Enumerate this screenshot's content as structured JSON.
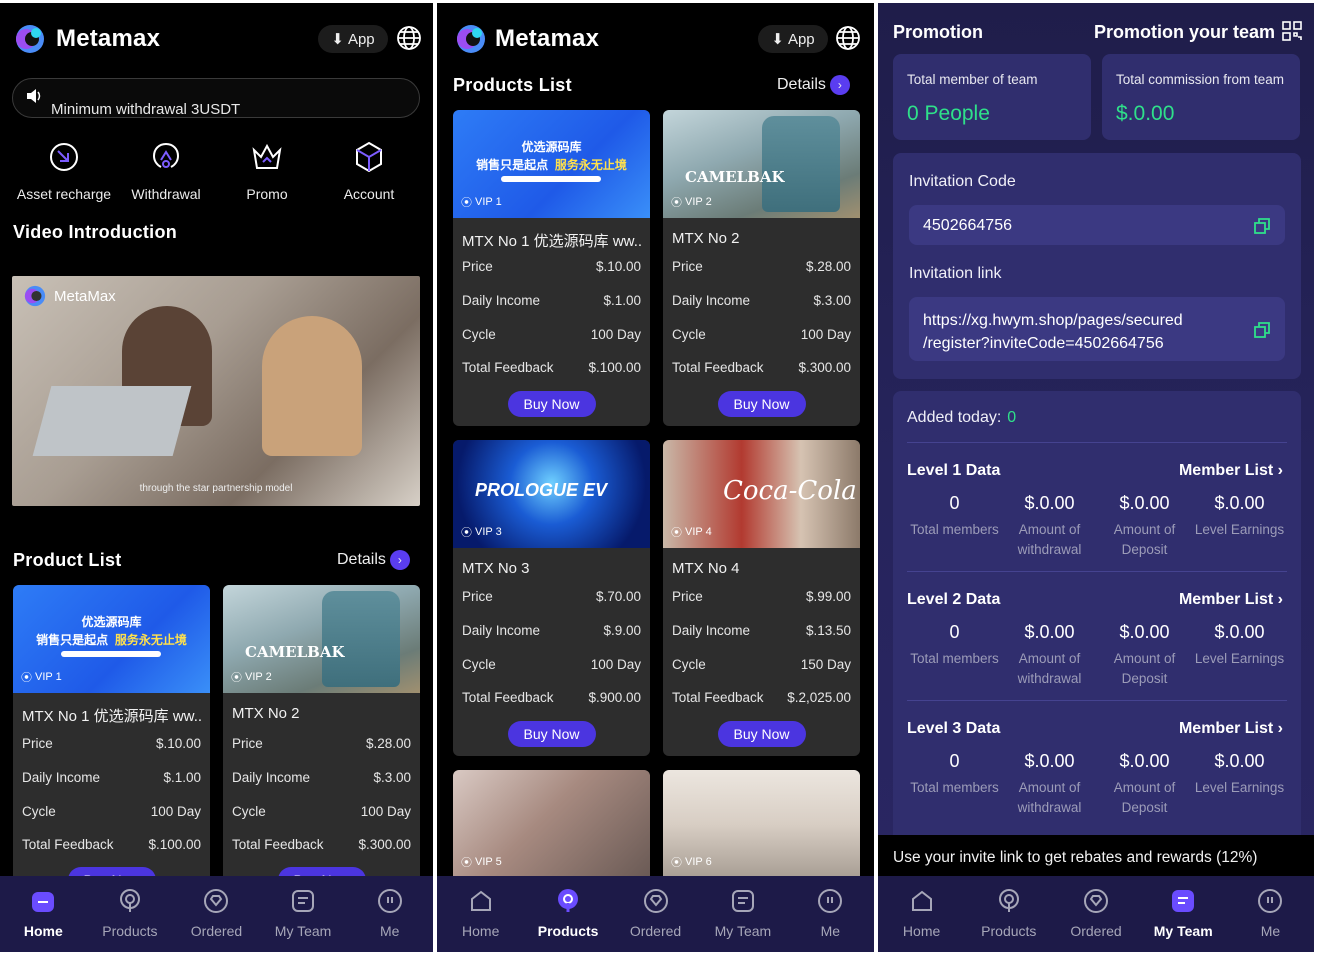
{
  "header": {
    "brand": "Metamax",
    "app_label": "App"
  },
  "home": {
    "notice": "Minimum withdrawal 3USDT",
    "actions": [
      "Asset recharge",
      "Withdrawal",
      "Promo",
      "Account"
    ],
    "video_title": "Video Introduction",
    "video_logo": "MetaMax",
    "video_caption": "through the star partnership model",
    "product_title": "Product List",
    "details": "Details"
  },
  "products_page": {
    "title": "Products List",
    "details": "Details"
  },
  "labels": {
    "price": "Price",
    "daily": "Daily Income",
    "cycle": "Cycle",
    "feedback": "Total Feedback",
    "buy": "Buy Now"
  },
  "products": [
    {
      "name": "MTX No 1 优选源码库 ww...",
      "vip": "VIP 1",
      "price": "$.10.00",
      "daily": "$.1.00",
      "cycle": "100 Day",
      "feedback": "$.100.00"
    },
    {
      "name": "MTX No 2",
      "vip": "VIP 2",
      "price": "$.28.00",
      "daily": "$.3.00",
      "cycle": "100 Day",
      "feedback": "$.300.00"
    },
    {
      "name": "MTX No 3",
      "vip": "VIP 3",
      "price": "$.70.00",
      "daily": "$.9.00",
      "cycle": "100 Day",
      "feedback": "$.900.00"
    },
    {
      "name": "MTX No 4",
      "vip": "VIP 4",
      "price": "$.99.00",
      "daily": "$.13.50",
      "cycle": "150 Day",
      "feedback": "$.2,025.00"
    },
    {
      "vip": "VIP 5"
    },
    {
      "vip": "VIP 6"
    }
  ],
  "banners": {
    "yx_title": "优选源码库",
    "yx_slogan_white": "销售只是起点",
    "yx_slogan_yellow": "服务永无止境",
    "camelbak": "CAMELBAK",
    "ev": "PROLOGUE EV",
    "coke": "Coca-Cola"
  },
  "team": {
    "title": "Promotion",
    "subtitle": "Promotion your team",
    "total_member_label": "Total member of team",
    "total_member_value": "0 People",
    "commission_label": "Total commission from team",
    "commission_value": "$.0.00",
    "invitation_code_label": "Invitation Code",
    "invitation_code": "4502664756",
    "invitation_link_label": "Invitation link",
    "invitation_link_1": "https://xg.hwym.shop/pages/secured",
    "invitation_link_2": "/register?inviteCode=4502664756",
    "added_today_label": "Added today:",
    "added_today_value": "0",
    "member_list": "Member List",
    "levels": [
      {
        "title": "Level 1 Data",
        "members": "0",
        "withdrawal": "$.0.00",
        "deposit": "$.0.00",
        "earnings": "$.0.00"
      },
      {
        "title": "Level 2 Data",
        "members": "0",
        "withdrawal": "$.0.00",
        "deposit": "$.0.00",
        "earnings": "$.0.00"
      },
      {
        "title": "Level 3 Data",
        "members": "0",
        "withdrawal": "$.0.00",
        "deposit": "$.0.00",
        "earnings": "$.0.00"
      }
    ],
    "col_labels": {
      "members": "Total members",
      "withdrawal_1": "Amount of",
      "withdrawal_2": "withdrawal",
      "deposit_1": "Amount of",
      "deposit_2": "Deposit",
      "earnings": "Level Earnings"
    },
    "invite_hint": "Use your invite link to get rebates and rewards (12%)"
  },
  "nav": [
    "Home",
    "Products",
    "Ordered",
    "My Team",
    "Me"
  ],
  "colors": {
    "accent": "#4b35e0",
    "positive": "#2fe08a",
    "nav_bg": "#1d1a48",
    "team_card": "#302e6e"
  }
}
